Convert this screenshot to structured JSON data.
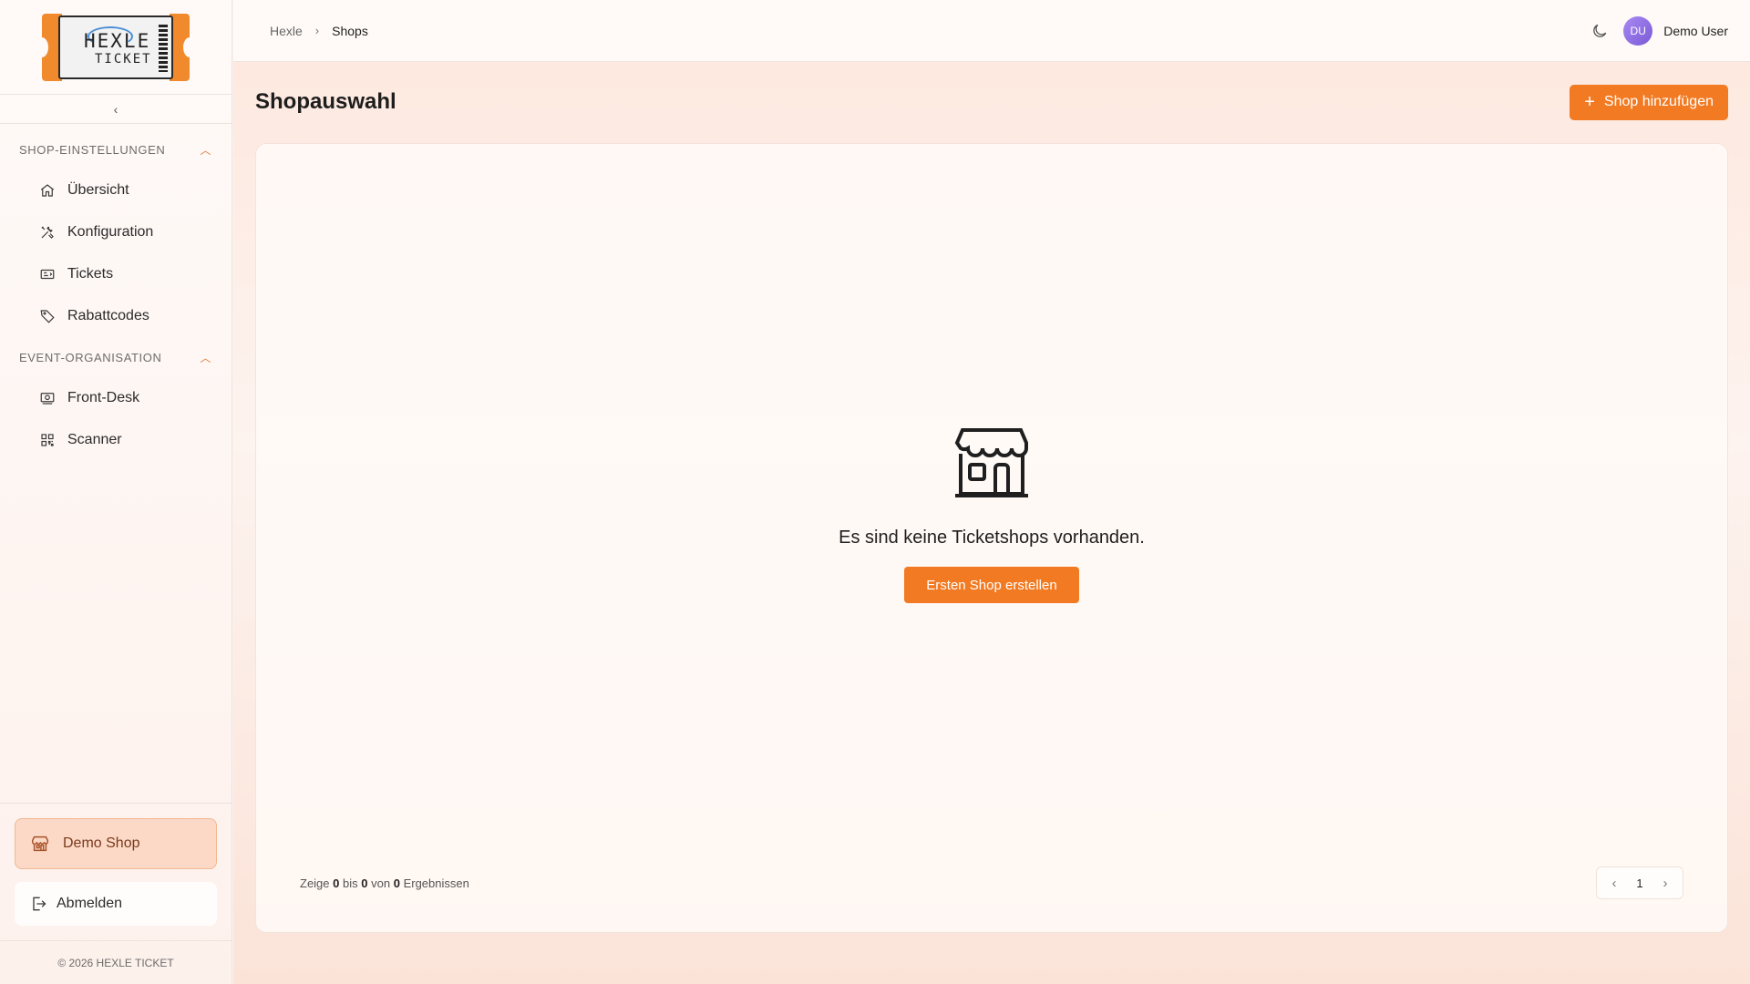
{
  "logo": {
    "line1": "HEXLE",
    "line2": "TICKET"
  },
  "sidebar": {
    "collapse_glyph": "‹",
    "sections": [
      {
        "title": "SHOP-EINSTELLUNGEN",
        "items": [
          {
            "label": "Übersicht",
            "icon": "home-icon"
          },
          {
            "label": "Konfiguration",
            "icon": "tools-icon"
          },
          {
            "label": "Tickets",
            "icon": "ticket-icon"
          },
          {
            "label": "Rabattcodes",
            "icon": "tag-icon"
          }
        ]
      },
      {
        "title": "EVENT-ORGANISATION",
        "items": [
          {
            "label": "Front-Desk",
            "icon": "cash-register-icon"
          },
          {
            "label": "Scanner",
            "icon": "qr-code-icon"
          }
        ]
      }
    ],
    "current_shop": "Demo Shop",
    "logout": "Abmelden",
    "copyright": "© 2026 HEXLE TICKET"
  },
  "topbar": {
    "breadcrumb": [
      "Hexle",
      "Shops"
    ],
    "user_initials": "DU",
    "user_name": "Demo User"
  },
  "page": {
    "title": "Shopauswahl",
    "add_button": "Shop hinzufügen",
    "empty_message": "Es sind keine Ticketshops vorhanden.",
    "empty_cta": "Ersten Shop erstellen",
    "results": {
      "prefix": "Zeige",
      "from": "0",
      "to_word": "bis",
      "to": "0",
      "of_word": "von",
      "total": "0",
      "suffix": "Ergebnissen"
    },
    "current_page": "1"
  },
  "colors": {
    "accent": "#f27a22",
    "shop_card_bg": "#fbd9c6",
    "avatar": "#8f6fe6"
  }
}
